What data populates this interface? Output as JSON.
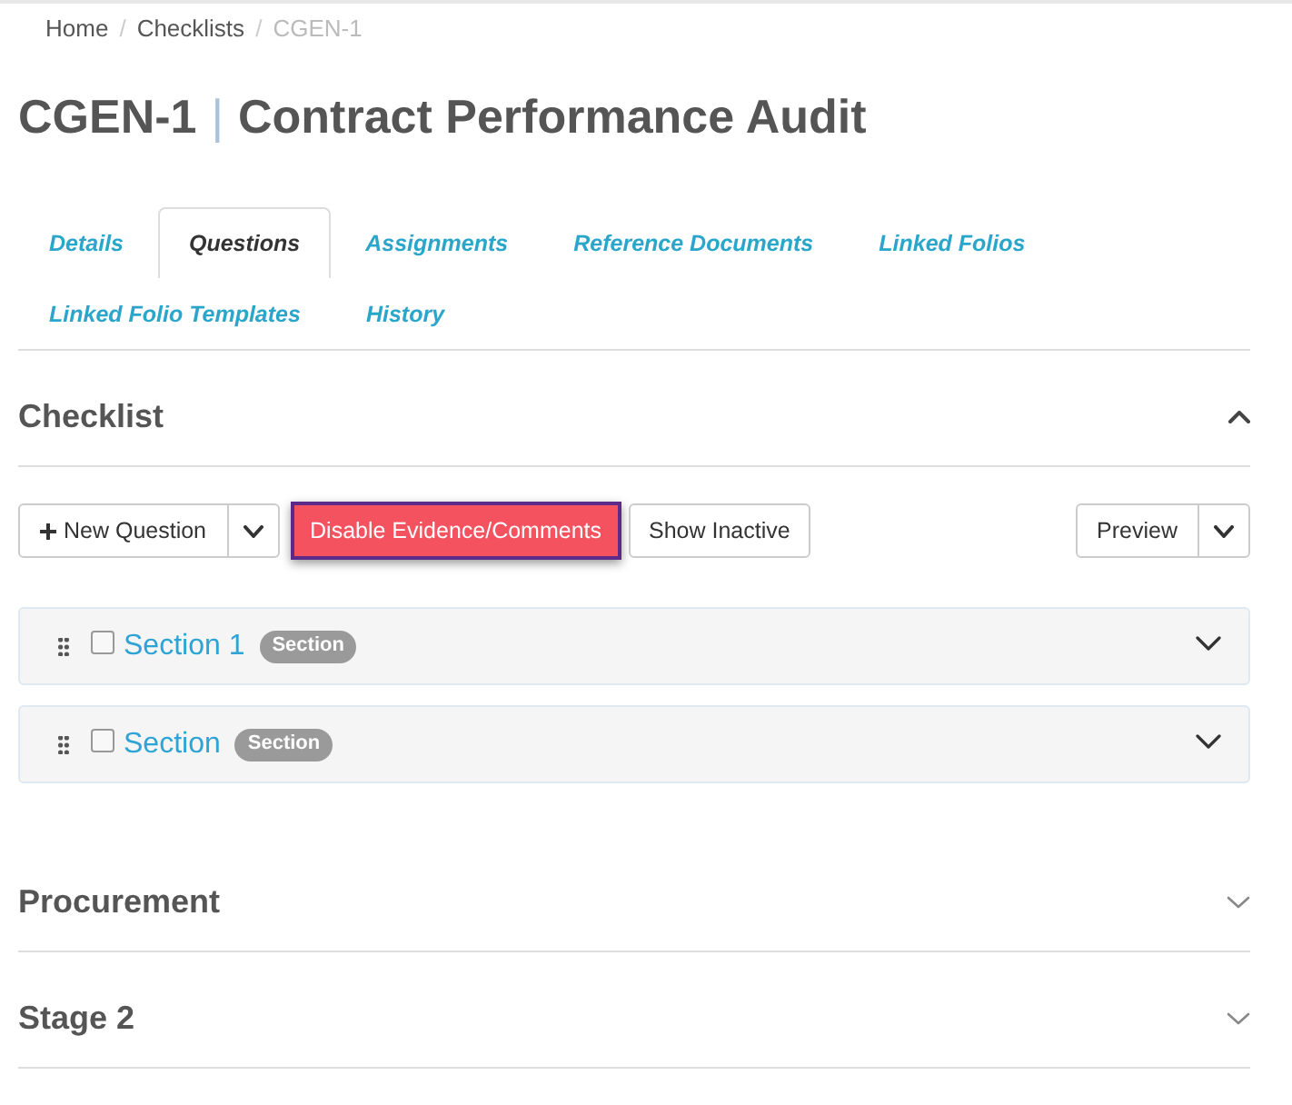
{
  "breadcrumb": {
    "separator": "/",
    "items": [
      {
        "label": "Home",
        "current": false
      },
      {
        "label": "Checklists",
        "current": false
      },
      {
        "label": "CGEN-1",
        "current": true
      }
    ]
  },
  "title": {
    "code": "CGEN-1",
    "separator": "|",
    "name": "Contract Performance Audit"
  },
  "tabs": [
    {
      "label": "Details",
      "selected": false
    },
    {
      "label": "Questions",
      "selected": true
    },
    {
      "label": "Assignments",
      "selected": false
    },
    {
      "label": "Reference Documents",
      "selected": false
    },
    {
      "label": "Linked Folios",
      "selected": false
    },
    {
      "label": "Linked Folio Templates",
      "selected": false
    },
    {
      "label": "History",
      "selected": false
    }
  ],
  "sections": [
    {
      "title": "Checklist",
      "expanded": true,
      "toolbar": {
        "new_question": {
          "label": "New Question"
        },
        "disable_evidence": {
          "label": "Disable Evidence/Comments",
          "focused": true
        },
        "show_inactive": {
          "label": "Show Inactive"
        },
        "preview": {
          "label": "Preview"
        }
      },
      "items": [
        {
          "title": "Section 1",
          "badge": "Section",
          "checked": false,
          "expanded": false
        },
        {
          "title": "Section",
          "badge": "Section",
          "checked": false,
          "expanded": false
        }
      ]
    },
    {
      "title": "Procurement",
      "expanded": false
    },
    {
      "title": "Stage 2",
      "expanded": false
    }
  ]
}
